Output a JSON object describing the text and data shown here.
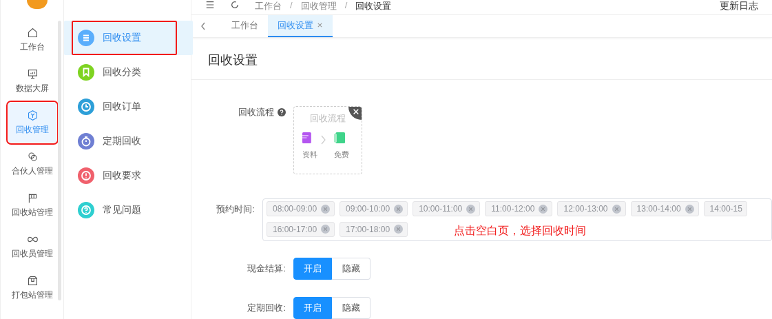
{
  "topbar": {
    "breadcrumb": [
      "工作台",
      "回收管理",
      "回收设置"
    ],
    "changelog": "更新日志",
    "separator": "/"
  },
  "rail": [
    {
      "label": "工作台",
      "selected": false,
      "highlighted": false
    },
    {
      "label": "数据大屏",
      "selected": false,
      "highlighted": false
    },
    {
      "label": "回收管理",
      "selected": true,
      "highlighted": true
    },
    {
      "label": "合伙人管理",
      "selected": false,
      "highlighted": false
    },
    {
      "label": "回收站管理",
      "selected": false,
      "highlighted": false
    },
    {
      "label": "回收员管理",
      "selected": false,
      "highlighted": false
    },
    {
      "label": "打包站管理",
      "selected": false,
      "highlighted": false
    }
  ],
  "submenu": [
    {
      "label": "回收设置",
      "selected": true,
      "highlighted": true,
      "color": "#5aaefc"
    },
    {
      "label": "回收分类",
      "selected": false,
      "highlighted": false,
      "color": "#7ed321"
    },
    {
      "label": "回收订单",
      "selected": false,
      "highlighted": false,
      "color": "#2d9fd8"
    },
    {
      "label": "定期回收",
      "selected": false,
      "highlighted": false,
      "color": "#6f7fd3"
    },
    {
      "label": "回收要求",
      "selected": false,
      "highlighted": false,
      "color": "#f0606c"
    },
    {
      "label": "常见问题",
      "selected": false,
      "highlighted": false,
      "color": "#2ecfd0"
    }
  ],
  "tabs": [
    {
      "label": "工作台",
      "selected": false,
      "closable": false
    },
    {
      "label": "回收设置",
      "selected": true,
      "closable": true
    }
  ],
  "page_title": "回收设置",
  "process": {
    "label": "回收流程",
    "card_title": "回收流程",
    "steps": [
      "资料",
      "免费"
    ]
  },
  "times": {
    "label": "预约时间:",
    "tags": [
      {
        "label": "08:00-09:00",
        "removable": true
      },
      {
        "label": "09:00-10:00",
        "removable": true
      },
      {
        "label": "10:00-11:00",
        "removable": true
      },
      {
        "label": "11:00-12:00",
        "removable": true
      },
      {
        "label": "12:00-13:00",
        "removable": true
      },
      {
        "label": "13:00-14:00",
        "removable": true
      },
      {
        "label": "14:00-15",
        "removable": false
      },
      {
        "label": "16:00-17:00",
        "removable": true
      },
      {
        "label": "17:00-18:00",
        "removable": true
      }
    ],
    "note": "点击空白页，选择回收时间"
  },
  "switches": [
    {
      "label": "现金结算:",
      "options": [
        {
          "label": "开启",
          "selected": true
        },
        {
          "label": "隐藏",
          "selected": false
        }
      ]
    },
    {
      "label": "定期回收:",
      "options": [
        {
          "label": "开启",
          "selected": true
        },
        {
          "label": "隐藏",
          "selected": false
        }
      ]
    }
  ]
}
